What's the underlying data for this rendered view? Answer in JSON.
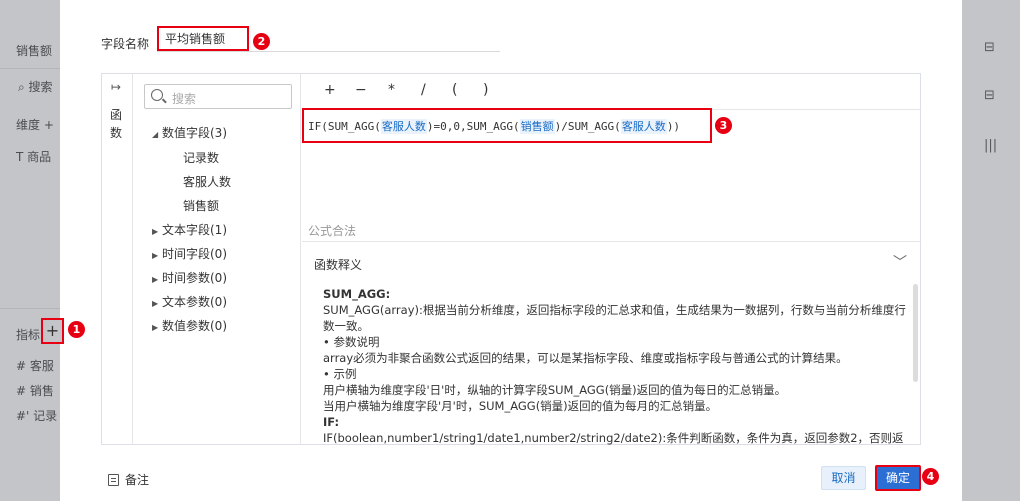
{
  "background": {
    "left_items": [
      "销售额",
      "搜索",
      "维度",
      "商品",
      "指标",
      "客服",
      "销售",
      "记录"
    ],
    "right_icons": [
      "briefcase-icon",
      "briefcase-icon",
      "barcode-icon"
    ]
  },
  "dialog": {
    "field_label": "字段名称",
    "field_value": "平均销售额",
    "side_label": "函数",
    "search_placeholder": "搜索",
    "tree": [
      {
        "label": "数值字段(3)",
        "expanded": true,
        "children": [
          "记录数",
          "客服人数",
          "销售额"
        ]
      },
      {
        "label": "文本字段(1)"
      },
      {
        "label": "时间字段(0)"
      },
      {
        "label": "时间参数(0)"
      },
      {
        "label": "文本参数(0)"
      },
      {
        "label": "数值参数(0)"
      }
    ],
    "operators": [
      "+",
      "−",
      "*",
      "/",
      "(",
      ")"
    ],
    "formula": {
      "p1": "IF(SUM_AGG(",
      "f1": "客服人数",
      "p2": ")=0,0,SUM_AGG(",
      "f2": "销售额",
      "p3": ")/SUM_AGG(",
      "f3": "客服人数",
      "p4": "))"
    },
    "valid_text": "公式合法",
    "explain_title": "函数释义",
    "explain_lines": [
      "SUM_AGG:",
      "SUM_AGG(array):根据当前分析维度，返回指标字段的汇总求和值，生成结果为一数据列，行数与当前分析维度行数一致。",
      "• 参数说明",
      "array必须为非聚合函数公式返回的结果，可以是某指标字段、维度或指标字段与普通公式的计算结果。",
      "• 示例",
      "用户横轴为维度字段'日'时，纵轴的计算字段SUM_AGG(销量)返回的值为每日的汇总销量。",
      "当用户横轴为维度字段'月'时，SUM_AGG(销量)返回的值为每月的汇总销量。",
      "IF:",
      "IF(boolean,number1/string1/date1,number2/string2/date2):条件判断函数，条件为真，返回参数2，否则返"
    ],
    "note_label": "备注",
    "cancel_label": "取消",
    "ok_label": "确定"
  },
  "markers": [
    "1",
    "2",
    "3",
    "4"
  ],
  "colors": {
    "accent": "#2b6fd4",
    "highlight": "#e60012"
  }
}
